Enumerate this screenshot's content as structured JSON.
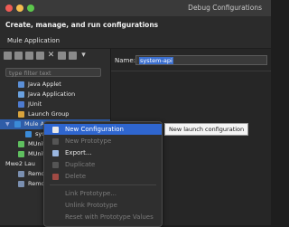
{
  "window": {
    "title": "Debug Configurations"
  },
  "header": {
    "title": "Create, manage, and run configurations",
    "subtitle": "Mule Application"
  },
  "filter": {
    "placeholder": "type filter text"
  },
  "tree": {
    "items": [
      {
        "label": "Java Applet"
      },
      {
        "label": "Java Application"
      },
      {
        "label": "JUnit"
      },
      {
        "label": "Launch Group"
      },
      {
        "label": "Mule A"
      },
      {
        "label": "syst"
      },
      {
        "label": "MUnit"
      },
      {
        "label": "MUnit"
      },
      {
        "label": "Mwe2 Lau"
      },
      {
        "label": "Remot"
      },
      {
        "label": "Remot"
      }
    ]
  },
  "config": {
    "name_label": "Name:",
    "name_value": "system-api"
  },
  "menu": {
    "items": [
      {
        "label": "New Configuration",
        "state": "active"
      },
      {
        "label": "New Prototype",
        "state": "disabled"
      },
      {
        "label": "Export...",
        "state": "enabled"
      },
      {
        "label": "Duplicate",
        "state": "disabled"
      },
      {
        "label": "Delete",
        "state": "disabled"
      },
      {
        "label": "Link Prototype...",
        "state": "disabled"
      },
      {
        "label": "Unlink Prototype",
        "state": "disabled"
      },
      {
        "label": "Reset with Prototype Values",
        "state": "disabled"
      }
    ]
  },
  "tooltip": {
    "text": "New launch configuration"
  },
  "colors": {
    "selection": "#2f5da8",
    "menu_active": "#2f66cf",
    "accent_icon": "#e45a4a"
  }
}
